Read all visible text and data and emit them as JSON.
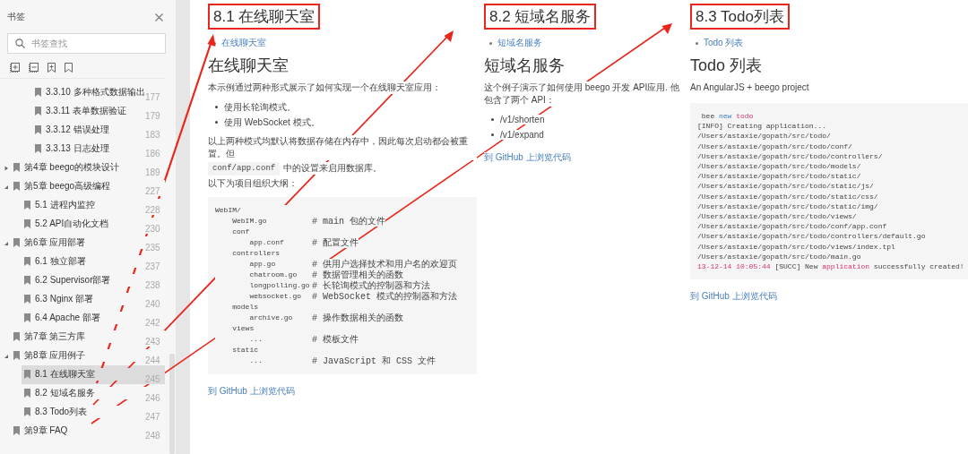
{
  "sidebar": {
    "title": "书签",
    "search": {
      "placeholder": "书签查找"
    },
    "tree": [
      {
        "children": [
          {
            "children": [
              {
                "label": "3.3.10 多种格式数据输出",
                "page": "177",
                "selected": false
              },
              {
                "label": "3.3.11 表单数据验证",
                "page": "179",
                "selected": false
              },
              {
                "label": "3.3.12 错误处理",
                "page": "183",
                "selected": false
              },
              {
                "label": "3.3.13 日志处理",
                "page": "186",
                "selected": false
              }
            ]
          }
        ]
      },
      {
        "label": "第4章 beego的模块设计",
        "page": "189",
        "expanded": false,
        "selected": false
      },
      {
        "label": "第5章 beego高级编程",
        "page": "227",
        "expanded": true,
        "selected": false,
        "children": [
          {
            "label": "5.1 进程内监控",
            "page": "228",
            "selected": false
          },
          {
            "label": "5.2 API自动化文档",
            "page": "230",
            "selected": false
          }
        ]
      },
      {
        "label": "第6章 应用部署",
        "page": "235",
        "expanded": true,
        "selected": false,
        "children": [
          {
            "label": "6.1 独立部署",
            "page": "237",
            "selected": false
          },
          {
            "label": "6.2 Supervisor部署",
            "page": "238",
            "selected": false
          },
          {
            "label": "6.3 Nginx 部署",
            "page": "240",
            "selected": false
          },
          {
            "label": "6.4 Apache 部署",
            "page": "242",
            "selected": false
          }
        ]
      },
      {
        "label": "第7章 第三方库",
        "page": "243",
        "selected": false
      },
      {
        "label": "第8章 应用例子",
        "page": "244",
        "expanded": true,
        "selected": false,
        "children": [
          {
            "label": "8.1 在线聊天室",
            "page": "245",
            "selected": true
          },
          {
            "label": "8.2 短域名服务",
            "page": "246",
            "selected": false
          },
          {
            "label": "8.3 Todo列表",
            "page": "247",
            "selected": false
          }
        ]
      },
      {
        "label": "第9章 FAQ",
        "page": "248",
        "selected": false
      }
    ]
  },
  "columns": [
    {
      "callout": "8.1 在线聊天室",
      "breadcrumb": "在线聊天室",
      "heading": "在线聊天室",
      "blocks": [
        {
          "kind": "para",
          "text": "本示例通过两种形式展示了如何实现一个在线聊天室应用："
        },
        {
          "kind": "bullets",
          "items": [
            "使用长轮询模式。",
            "使用 WebSocket 模式。"
          ]
        },
        {
          "kind": "para_code",
          "text": "以上两种模式均默认将数据存储在内存中，因此每次启动都会被重置。但",
          "code": "conf/app.conf",
          "after": "中的设置来启用数据库。"
        },
        {
          "kind": "para",
          "text": "以下为项目组织大纲："
        },
        {
          "kind": "tree_code",
          "lines": [
            {
              "path": "WebIM/"
            },
            {
              "path": "    WebIM.go",
              "comment": "# main 包的文件"
            },
            {
              "path": "    conf"
            },
            {
              "path": "        app.conf",
              "comment": "# 配置文件"
            },
            {
              "path": "    controllers"
            },
            {
              "path": "        app.go",
              "comment": "# 供用户选择技术和用户名的欢迎页"
            },
            {
              "path": "        chatroom.go",
              "comment": "# 数据管理相关的函数"
            },
            {
              "path": "        longpolling.go",
              "comment": "# 长轮询模式的控制器和方法"
            },
            {
              "path": "        websocket.go",
              "comment": "# WebSocket 模式的控制器和方法"
            },
            {
              "path": "    models"
            },
            {
              "path": "        archive.go",
              "comment": "# 操作数据相关的函数"
            },
            {
              "path": "    views"
            },
            {
              "path": "        ...",
              "comment": "# 模板文件"
            },
            {
              "path": "    static"
            },
            {
              "path": "        ...",
              "comment": "# JavaScript 和 CSS 文件"
            }
          ]
        },
        {
          "kind": "link",
          "text": "到 GitHub 上浏览代码"
        }
      ]
    },
    {
      "callout": "8.2 短域名服务",
      "breadcrumb": "短域名服务",
      "heading": "短域名服务",
      "blocks": [
        {
          "kind": "para",
          "text": "这个例子演示了如何使用 beego 开发 API应用. 他包含了两个 API："
        },
        {
          "kind": "bullets",
          "items": [
            "/v1/shorten",
            "/v1/expand"
          ]
        },
        {
          "kind": "link",
          "text": "到 GitHub 上浏览代码"
        }
      ]
    },
    {
      "callout": "8.3 Todo列表",
      "breadcrumb": "Todo 列表",
      "heading": "Todo 列表",
      "blocks": [
        {
          "kind": "para",
          "text": "An AngularJS + beego project"
        },
        {
          "kind": "shell",
          "lines": [
            [
              {
                "kind": "plain",
                "text": " bee "
              },
              {
                "kind": "keyword",
                "text": "new"
              },
              {
                "kind": "accent",
                "text": " todo"
              }
            ],
            [
              {
                "kind": "plain",
                "text": "[INFO] Creating application..."
              }
            ],
            [
              {
                "kind": "plain",
                "text": "/Users/astaxie/gopath/src/todo/"
              }
            ],
            [
              {
                "kind": "plain",
                "text": "/Users/astaxie/gopath/src/todo/conf/"
              }
            ],
            [
              {
                "kind": "plain",
                "text": "/Users/astaxie/gopath/src/todo/controllers/"
              }
            ],
            [
              {
                "kind": "plain",
                "text": "/Users/astaxie/gopath/src/todo/models/"
              }
            ],
            [
              {
                "kind": "plain",
                "text": "/Users/astaxie/gopath/src/todo/static/"
              }
            ],
            [
              {
                "kind": "plain",
                "text": "/Users/astaxie/gopath/src/todo/static/js/"
              }
            ],
            [
              {
                "kind": "plain",
                "text": "/Users/astaxie/gopath/src/todo/static/css/"
              }
            ],
            [
              {
                "kind": "plain",
                "text": "/Users/astaxie/gopath/src/todo/static/img/"
              }
            ],
            [
              {
                "kind": "plain",
                "text": "/Users/astaxie/gopath/src/todo/views/"
              }
            ],
            [
              {
                "kind": "plain",
                "text": "/Users/astaxie/gopath/src/todo/conf/app.conf"
              }
            ],
            [
              {
                "kind": "plain",
                "text": "/Users/astaxie/gopath/src/todo/controllers/default.go"
              }
            ],
            [
              {
                "kind": "plain",
                "text": "/Users/astaxie/gopath/src/todo/views/index.tpl"
              }
            ],
            [
              {
                "kind": "plain",
                "text": "/Users/astaxie/gopath/src/todo/main.go"
              }
            ],
            [
              {
                "kind": "accent",
                "text": "13-12-14 10:05:44"
              },
              {
                "kind": "plain",
                "text": " [SUCC] New "
              },
              {
                "kind": "accent",
                "text": "application"
              },
              {
                "kind": "plain",
                "text": " successfully created!"
              }
            ]
          ]
        },
        {
          "kind": "link",
          "text": "到 GitHub 上浏览代码"
        }
      ]
    }
  ]
}
